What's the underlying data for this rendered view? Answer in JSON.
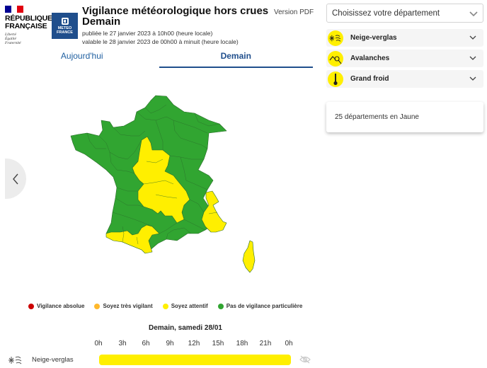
{
  "header": {
    "republic": {
      "line1": "RÉPUBLIQUE",
      "line2": "FRANÇAISE",
      "motto": [
        "Liberté",
        "Égalité",
        "Fraternité"
      ],
      "flag_colors": [
        "#000091",
        "#ffffff",
        "#e1000f"
      ]
    },
    "meteo_logo": {
      "line1": "METEO",
      "line2": "FRANCE",
      "color": "#1f4e8c"
    },
    "title_line1": "Vigilance météorologique hors crues",
    "title_line2": "Demain",
    "published": "publiée le 27 janvier 2023 à 10h00 (heure locale)",
    "valid": "valable le 28 janvier 2023 de 00h00 à minuit (heure locale)",
    "pdf_link": "Version PDF"
  },
  "tabs": [
    {
      "label": "Aujourd'hui",
      "active": false
    },
    {
      "label": "Demain",
      "active": true
    }
  ],
  "map": {
    "green_color": "#31a531",
    "yellow_color": "#ffef00",
    "yellow_departments_count": 25
  },
  "legend": [
    {
      "label": "Vigilance absolue",
      "color": "#cc0000"
    },
    {
      "label": "Soyez très vigilant",
      "color": "#ffb82b"
    },
    {
      "label": "Soyez attentif",
      "color": "#ffef00"
    },
    {
      "label": "Pas de vigilance particulière",
      "color": "#31a531"
    }
  ],
  "timeline": {
    "title": "Demain, samedi 28/01",
    "hours": [
      "0h",
      "3h",
      "6h",
      "9h",
      "12h",
      "15h",
      "18h",
      "21h",
      "0h"
    ],
    "rows": [
      {
        "label": "Neige-verglas",
        "icon": "snow-ice-icon",
        "level_color": "#ffef00",
        "coverage_fraction": 1.0
      }
    ]
  },
  "sidebar": {
    "department_select": {
      "placeholder": "Choisissez votre département"
    },
    "risks": [
      {
        "label": "Neige-verglas",
        "icon": "snow-ice-icon",
        "color": "#ffef00"
      },
      {
        "label": "Avalanches",
        "icon": "avalanche-icon",
        "color": "#ffef00"
      },
      {
        "label": "Grand froid",
        "icon": "thermometer-icon",
        "color": "#ffef00"
      }
    ],
    "summary": "25 départements en Jaune"
  }
}
